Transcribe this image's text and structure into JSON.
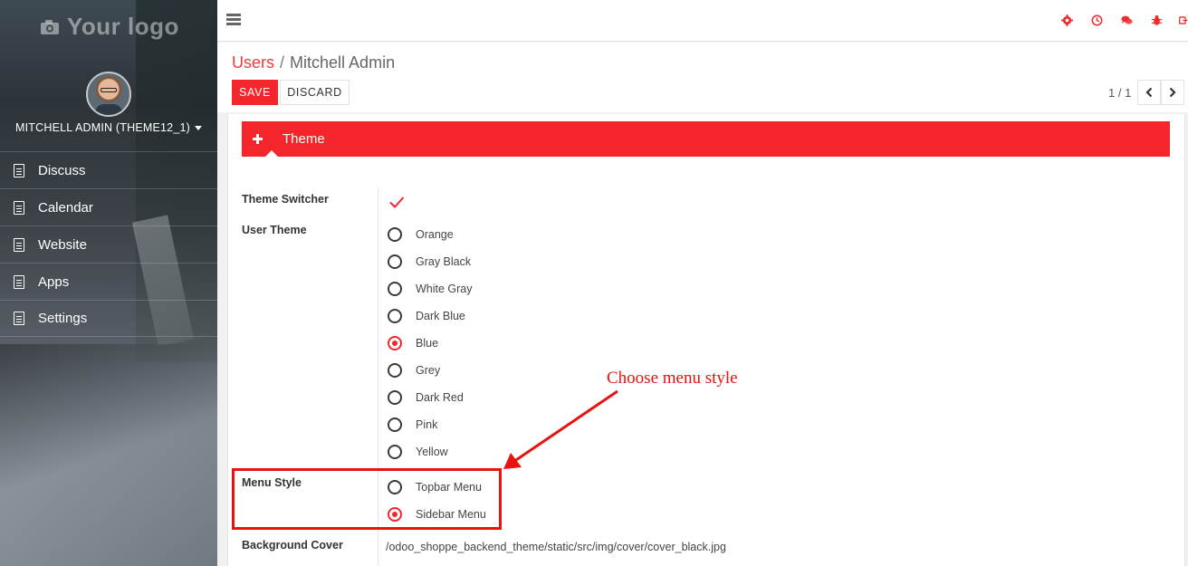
{
  "colors": {
    "accent": "#f4262b",
    "annotation": "#e8120f"
  },
  "sidebar": {
    "logo_text": "Your logo",
    "logo_icon": "camera-icon",
    "user_name": "MITCHELL ADMIN (THEME12_1)",
    "items": [
      {
        "label": "Discuss",
        "icon": "document-icon"
      },
      {
        "label": "Calendar",
        "icon": "document-icon"
      },
      {
        "label": "Website",
        "icon": "document-icon"
      },
      {
        "label": "Apps",
        "icon": "document-icon"
      },
      {
        "label": "Settings",
        "icon": "document-icon"
      }
    ]
  },
  "topbar": {
    "icons": [
      "settings-icon",
      "clock-icon",
      "chat-icon",
      "bug-icon",
      "logout-icon"
    ]
  },
  "breadcrumb": {
    "parent": "Users",
    "separator": "/",
    "current": "Mitchell Admin"
  },
  "toolbar": {
    "save_label": "SAVE",
    "discard_label": "DISCARD"
  },
  "pager": {
    "value": "1 / 1"
  },
  "form": {
    "section_title": "Theme",
    "theme_switcher_label": "Theme Switcher",
    "theme_switcher_checked": true,
    "user_theme_label": "User Theme",
    "user_theme_options": [
      "Orange",
      "Gray Black",
      "White Gray",
      "Dark Blue",
      "Blue",
      "Grey",
      "Dark Red",
      "Pink",
      "Yellow"
    ],
    "user_theme_selected": "Blue",
    "menu_style_label": "Menu Style",
    "menu_style_options": [
      "Topbar Menu",
      "Sidebar Menu"
    ],
    "menu_style_selected": "Sidebar Menu",
    "background_cover_label": "Background Cover",
    "background_cover_value": "/odoo_shoppe_backend_theme/static/src/img/cover/cover_black.jpg"
  },
  "annotation": {
    "text": "Choose menu style"
  }
}
